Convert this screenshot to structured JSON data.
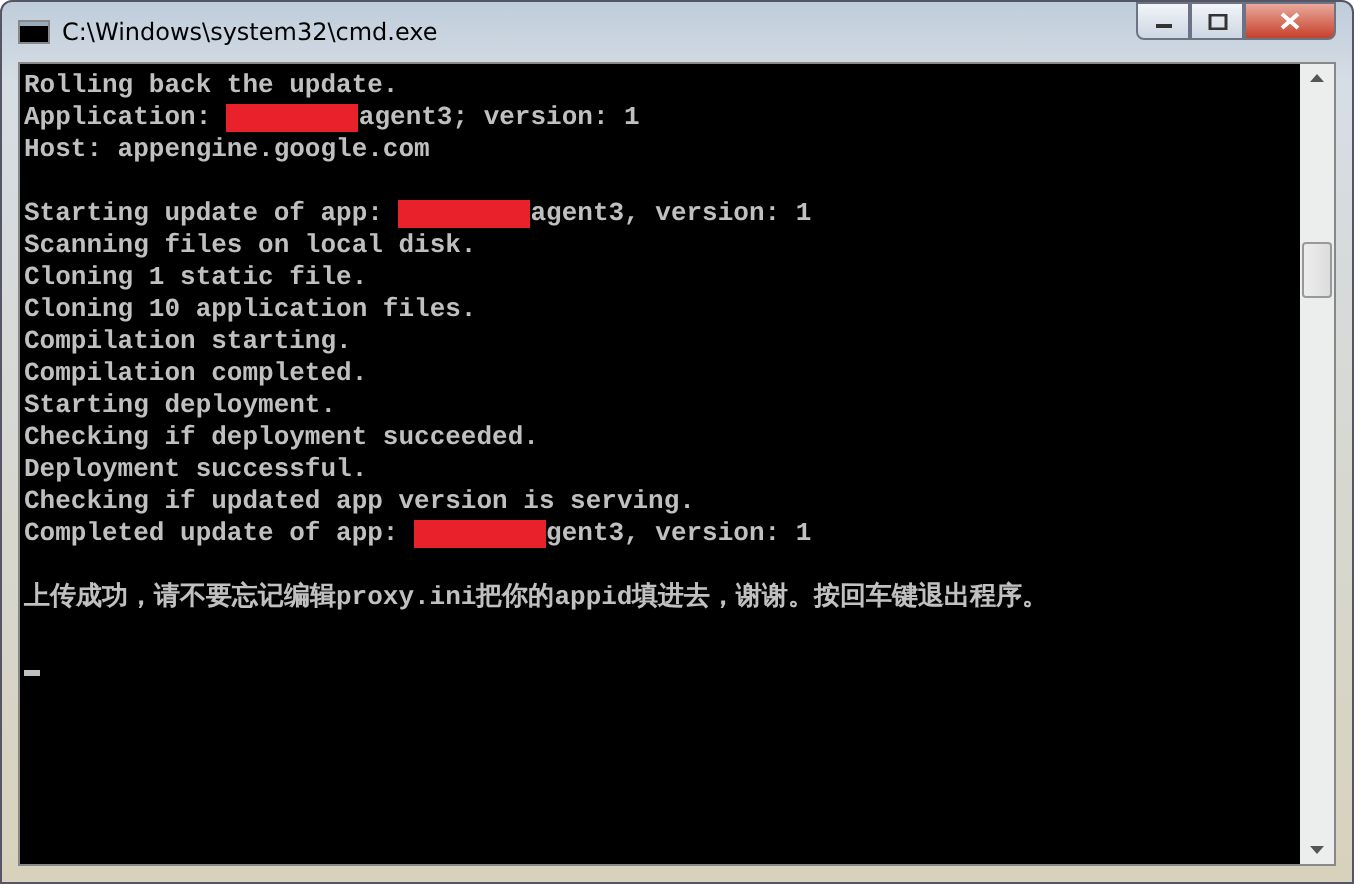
{
  "window": {
    "title": "C:\\Windows\\system32\\cmd.exe"
  },
  "console": {
    "lines": [
      {
        "kind": "plain",
        "text": "Rolling back the update."
      },
      {
        "kind": "redacted",
        "before": "Application: ",
        "after": "agent3; version: 1"
      },
      {
        "kind": "plain",
        "text": "Host: appengine.google.com"
      },
      {
        "kind": "blank"
      },
      {
        "kind": "redacted",
        "before": "Starting update of app: ",
        "after": "agent3, version: 1"
      },
      {
        "kind": "plain",
        "text": "Scanning files on local disk."
      },
      {
        "kind": "plain",
        "text": "Cloning 1 static file."
      },
      {
        "kind": "plain",
        "text": "Cloning 10 application files."
      },
      {
        "kind": "plain",
        "text": "Compilation starting."
      },
      {
        "kind": "plain",
        "text": "Compilation completed."
      },
      {
        "kind": "plain",
        "text": "Starting deployment."
      },
      {
        "kind": "plain",
        "text": "Checking if deployment succeeded."
      },
      {
        "kind": "plain",
        "text": "Deployment successful."
      },
      {
        "kind": "plain",
        "text": "Checking if updated app version is serving."
      },
      {
        "kind": "redacted",
        "before": "Completed update of app: ",
        "after": "gent3, version: 1"
      },
      {
        "kind": "blank"
      },
      {
        "kind": "plain",
        "text": "上传成功，请不要忘记编辑proxy.ini把你的appid填进去，谢谢。按回车键退出程序。"
      },
      {
        "kind": "blank"
      },
      {
        "kind": "cursor"
      }
    ]
  }
}
